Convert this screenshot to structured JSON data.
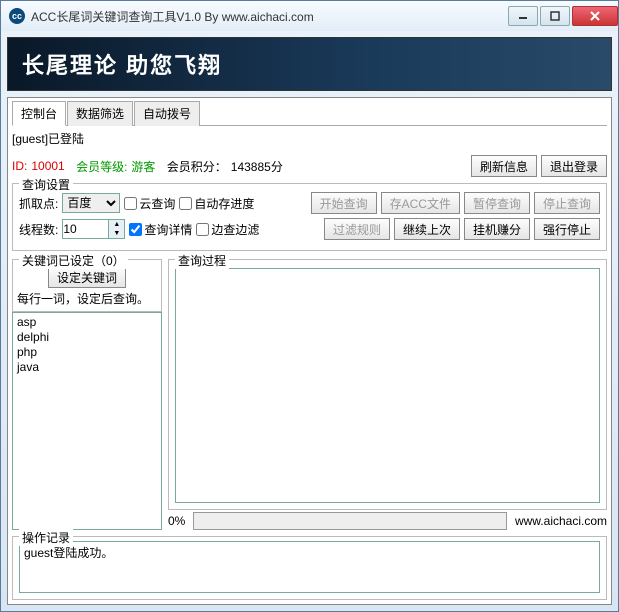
{
  "window": {
    "title": "ACC长尾词关键词查询工具V1.0  By  www.aichaci.com"
  },
  "banner": "长尾理论 助您飞翔",
  "tabs": [
    "控制台",
    "数据筛选",
    "自动拨号"
  ],
  "status": {
    "login": "[guest]已登陆",
    "id_label": "ID:",
    "id_value": "10001",
    "level_label": "会员等级:",
    "level_value": "游客",
    "points_label": "会员积分：",
    "points_value": "143885分",
    "refresh": "刷新信息",
    "logout": "退出登录"
  },
  "query": {
    "title": "查询设置",
    "grab_label": "抓取点:",
    "grab_value": "百度",
    "cloud": "云查询",
    "autosave": "自动存进度",
    "start": "开始查询",
    "saveacc": "存ACC文件",
    "pause": "暂停查询",
    "stop": "停止查询",
    "threads_label": "线程数:",
    "threads_value": "10",
    "detail": "查询详情",
    "edgefilter": "边查边滤",
    "filter_rule": "过滤规则",
    "resume": "继续上次",
    "hang": "挂机赚分",
    "force_stop": "强行停止"
  },
  "keywords": {
    "title": "关键词已设定（0）",
    "set_btn": "设定关键词",
    "hint": "每行一词，设定后查询。",
    "items": [
      "asp",
      "delphi",
      "php",
      "java"
    ]
  },
  "process": {
    "title": "查询过程",
    "progress": "0%",
    "site": "www.aichaci.com"
  },
  "log": {
    "title": "操作记录",
    "text": "guest登陆成功。"
  }
}
